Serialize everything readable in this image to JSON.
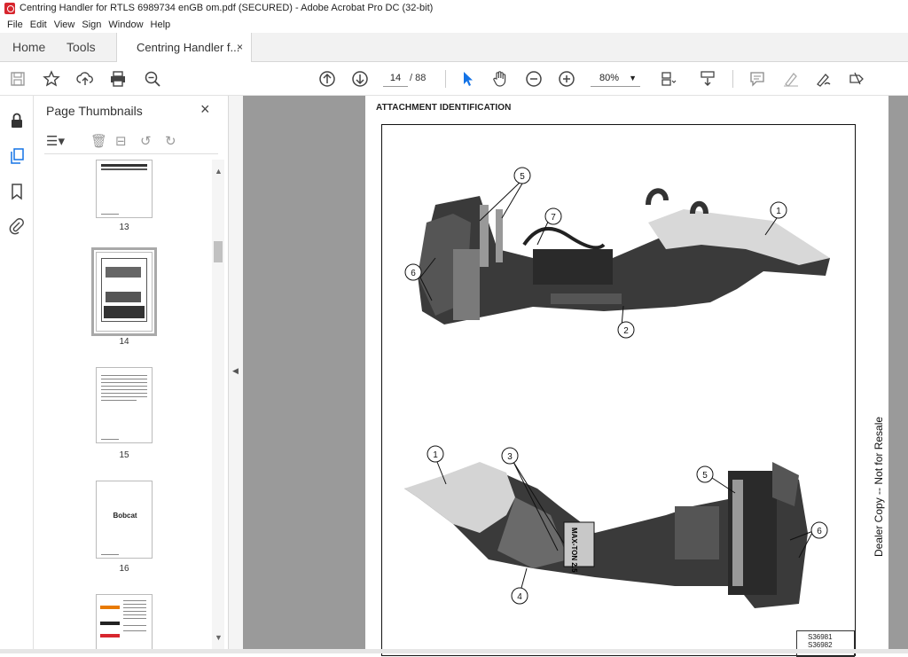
{
  "window": {
    "title": "Centring Handler for RTLS 6989734 enGB om.pdf (SECURED) - Adobe Acrobat Pro DC (32-bit)"
  },
  "menu": [
    "File",
    "Edit",
    "View",
    "Sign",
    "Window",
    "Help"
  ],
  "tabs": {
    "home": "Home",
    "tools": "Tools",
    "document": "Centring Handler f...",
    "close": "×"
  },
  "toolbar": {
    "current_page": "14",
    "total_pages": "/ 88",
    "zoom": "80%"
  },
  "panel": {
    "title": "Page Thumbnails",
    "close": "×",
    "thumbs": [
      {
        "page": "13",
        "selected": false
      },
      {
        "page": "14",
        "selected": true
      },
      {
        "page": "15",
        "selected": false
      },
      {
        "page": "16",
        "selected": false,
        "logo": "Bobcat"
      }
    ]
  },
  "document": {
    "heading": "ATTACHMENT IDENTIFICATION",
    "callouts_top": [
      "1",
      "2",
      "5",
      "6",
      "7"
    ],
    "callouts_bottom": [
      "1",
      "3",
      "4",
      "5",
      "6"
    ],
    "decal": "MAX-TON 2.5",
    "figure_codes": [
      "S36981",
      "S36982"
    ],
    "watermark": "Dealer Copy -- Not for Resale"
  }
}
